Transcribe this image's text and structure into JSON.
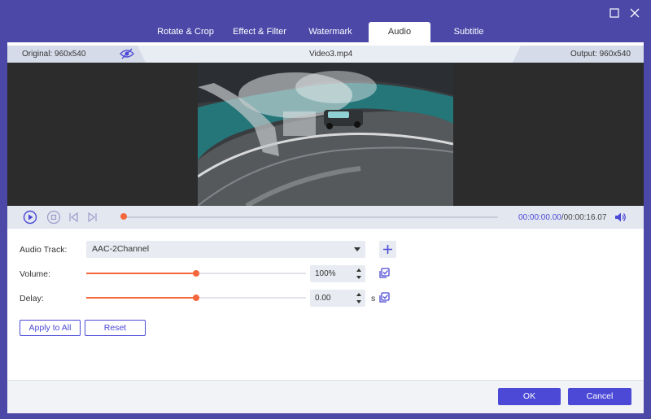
{
  "window": {
    "maximize_icon": "maximize-icon",
    "close_icon": "close-icon"
  },
  "tabs": [
    {
      "label": "Rotate & Crop",
      "active": false
    },
    {
      "label": "Effect & Filter",
      "active": false
    },
    {
      "label": "Watermark",
      "active": false
    },
    {
      "label": "Audio",
      "active": true
    },
    {
      "label": "Subtitle",
      "active": false
    }
  ],
  "info": {
    "original": "Original: 960x540",
    "filename": "Video3.mp4",
    "output": "Output: 960x540",
    "eye_icon": "eye-icon"
  },
  "player": {
    "current_time": "00:00:00.00",
    "total_time": "/00:00:16.07",
    "progress": 0.0,
    "icons": [
      "play-icon",
      "stop-icon",
      "previous-frame-icon",
      "next-frame-icon",
      "volume-icon"
    ]
  },
  "audio": {
    "track_label": "Audio Track:",
    "track_value": "AAC-2Channel",
    "volume_label": "Volume:",
    "volume_value": "100%",
    "volume_level": 0.5,
    "delay_label": "Delay:",
    "delay_value": "0.00",
    "delay_unit": "s",
    "delay_level": 0.5
  },
  "buttons": {
    "apply_to_all": "Apply to All",
    "reset": "Reset",
    "ok": "OK",
    "cancel": "Cancel"
  },
  "colors": {
    "accent": "#4b49d6",
    "slider": "#f4673b",
    "frame": "#4b48a8"
  }
}
